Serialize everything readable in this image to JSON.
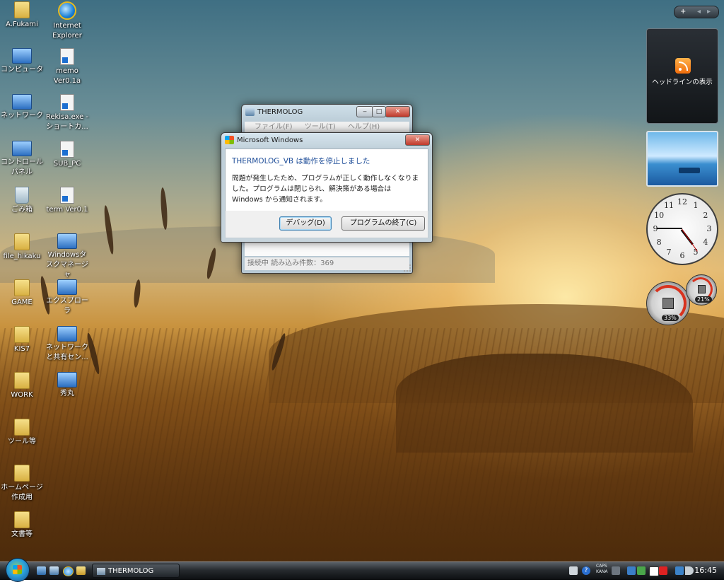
{
  "desktop_icons": [
    {
      "name": "icon-a-fukami",
      "label": "A.Fukami",
      "type": "folder"
    },
    {
      "name": "icon-internet-explorer",
      "label": "Internet Explorer",
      "type": "ie"
    },
    {
      "name": "icon-computer",
      "label": "コンピュータ",
      "type": "pc"
    },
    {
      "name": "icon-memo",
      "label": "memo Ver0.1a",
      "type": "shortcut"
    },
    {
      "name": "icon-network",
      "label": "ネットワーク",
      "type": "pc"
    },
    {
      "name": "icon-rekisa",
      "label": "Rekisa.exe - ショートカ...",
      "type": "shortcut"
    },
    {
      "name": "icon-control-panel",
      "label": "コントロール パネル",
      "type": "pc"
    },
    {
      "name": "icon-sub-pc",
      "label": "SUB_PC",
      "type": "shortcut"
    },
    {
      "name": "icon-recycle-bin",
      "label": "ごみ箱",
      "type": "bin"
    },
    {
      "name": "icon-term",
      "label": "term Ver0.1",
      "type": "shortcut"
    },
    {
      "name": "icon-file-hikaku",
      "label": "file_hikaku",
      "type": "folder"
    },
    {
      "name": "icon-task-manager",
      "label": "Windowsタスクマネージャ",
      "type": "pc"
    },
    {
      "name": "icon-game",
      "label": "GAME",
      "type": "folder"
    },
    {
      "name": "icon-explorer",
      "label": "エクスプローラ",
      "type": "pc"
    },
    {
      "name": "icon-kis7",
      "label": "KIS7",
      "type": "folder"
    },
    {
      "name": "icon-network-center",
      "label": "ネットワークと共有セン...",
      "type": "pc"
    },
    {
      "name": "icon-work",
      "label": "WORK",
      "type": "folder"
    },
    {
      "name": "icon-hidemaru",
      "label": "秀丸",
      "type": "pc"
    },
    {
      "name": "icon-tools",
      "label": "ツール等",
      "type": "folder"
    },
    {
      "name": "icon-homepage",
      "label": "ホームページ作成用",
      "type": "folder"
    },
    {
      "name": "icon-documents",
      "label": "文書等",
      "type": "folder"
    }
  ],
  "thermolog": {
    "title": "THERMOLOG",
    "menu": [
      "ファイル(F)",
      "ツール(T)",
      "ヘルプ(H)"
    ],
    "status": "接続中  読み込み件数：369"
  },
  "dialog": {
    "title": "Microsoft Windows",
    "heading": "THERMOLOG_VB は動作を停止しました",
    "message": "問題が発生したため、プログラムが正しく動作しなくなりました。プログラムは閉じられ、解決策がある場合は Windows から通知されます。",
    "debug_button": "デバッグ(D)",
    "close_button": "プログラムの終了(C)"
  },
  "sidebar": {
    "add_button": "+",
    "headline_label": "ヘッドラインの表示",
    "clock_numbers": [
      "12",
      "1",
      "2",
      "3",
      "4",
      "5",
      "6",
      "7",
      "8",
      "9",
      "10",
      "11"
    ],
    "cpu_percent": "33%",
    "memory_percent": "21%"
  },
  "taskbar": {
    "task_label": "THERMOLOG",
    "caps": "CAPS",
    "kana": "KANA",
    "time": "16:45"
  },
  "colors": {
    "dialog_heading": "#1f4e99",
    "close_button": "#c0392b"
  }
}
